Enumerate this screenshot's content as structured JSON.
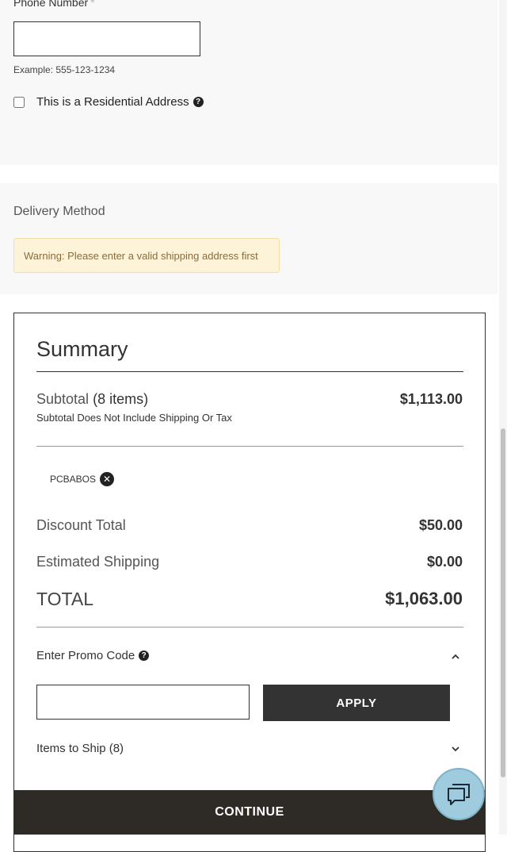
{
  "shipping_form": {
    "phone_label": "Phone Number",
    "phone_required_mark": "*",
    "phone_value": "",
    "phone_example": "Example: 555-123-1234",
    "residential_label": "This is a Residential Address",
    "residential_checked": false
  },
  "delivery": {
    "title": "Delivery Method",
    "warning": "Warning: Please enter a valid shipping address first"
  },
  "summary": {
    "title": "Summary",
    "subtotal_label": "Subtotal",
    "subtotal_count": "(8 items)",
    "subtotal_value": "$1,113.00",
    "subtotal_note": "Subtotal Does Not Include Shipping Or Tax",
    "coupon_code": "PCBABOS",
    "discount_label": "Discount Total",
    "discount_value": "$50.00",
    "shipping_label": "Estimated Shipping",
    "shipping_value": "$0.00",
    "total_label": "TOTAL",
    "total_value": "$1,063.00",
    "promo_label": "Enter Promo Code",
    "promo_value": "",
    "apply_label": "APPLY",
    "items_label": "Items to Ship (8)"
  },
  "continue_label": "CONTINUE",
  "colors": {
    "warning_bg": "#fcf3d9",
    "warning_text": "#8a6d3b",
    "button_dark": "#333333",
    "continue_bg": "#2e2a26",
    "chat_bg": "#9ecbdd"
  },
  "icons": {
    "help": "question-circle-icon",
    "remove": "close-circle-icon",
    "chevron_up": "chevron-up-icon",
    "chevron_down": "chevron-down-icon",
    "chat": "chat-bubbles-icon"
  }
}
